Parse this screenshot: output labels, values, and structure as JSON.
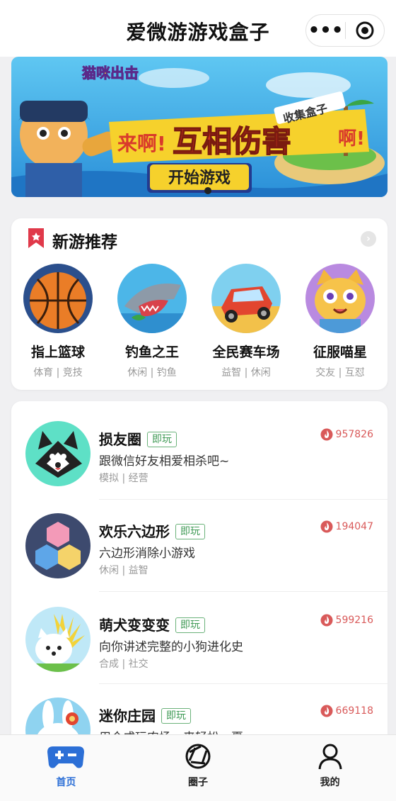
{
  "header": {
    "title": "爱微游游戏盒子",
    "more_icon": "more-dots-icon",
    "close_icon": "target-circle-icon"
  },
  "banner": {
    "game_logo": "猫咪出击",
    "slogan_left": "来啊!",
    "slogan_main": "互相伤害",
    "slogan_right": "啊!",
    "sign_text": "收集盒子",
    "button_text": "开始游戏"
  },
  "new_games": {
    "title": "新游推荐",
    "items": [
      {
        "name": "指上篮球",
        "tags": "体育 | 竞技",
        "icon": "basketball-icon"
      },
      {
        "name": "钓鱼之王",
        "tags": "休闲 | 钓鱼",
        "icon": "shark-icon"
      },
      {
        "name": "全民赛车场",
        "tags": "益智 | 休闲",
        "icon": "race-car-icon"
      },
      {
        "name": "征服喵星",
        "tags": "交友 | 互怼",
        "icon": "cat-icon"
      }
    ]
  },
  "game_list": {
    "badge": "即玩",
    "items": [
      {
        "name": "损友圈",
        "desc": "跟微信好友相爱相杀吧~",
        "tags": "模拟 | 经营",
        "heat": "957826",
        "icon": "husky-dog-icon"
      },
      {
        "name": "欢乐六边形",
        "desc": "六边形消除小游戏",
        "tags": "休闲 | 益智",
        "heat": "194047",
        "icon": "hexagon-icon"
      },
      {
        "name": "萌犬变变变",
        "desc": "向你讲述完整的小狗进化史",
        "tags": "合成 | 社交",
        "heat": "599216",
        "icon": "puppy-icon"
      },
      {
        "name": "迷你庄园",
        "desc": "用合成玩农场，来轻松一夏",
        "tags": "",
        "heat": "669118",
        "icon": "bunny-icon"
      }
    ]
  },
  "tabbar": {
    "items": [
      {
        "label": "首页",
        "icon": "gamepad-icon",
        "active": true
      },
      {
        "label": "圈子",
        "icon": "circle-aperture-icon",
        "active": false
      },
      {
        "label": "我的",
        "icon": "user-icon",
        "active": false
      }
    ]
  },
  "colors": {
    "accent": "#2c6fd6",
    "badge": "#3f9a55",
    "heat": "#d95a5a",
    "bookmark": "#e0394a"
  }
}
